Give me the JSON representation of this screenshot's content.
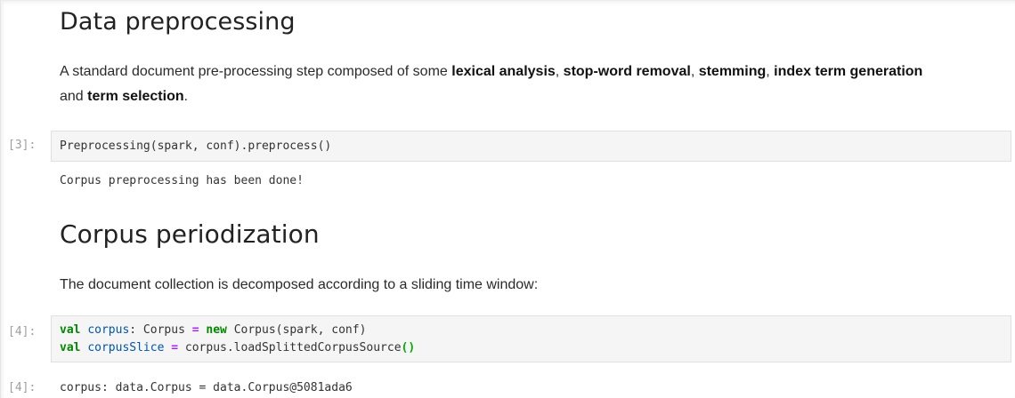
{
  "sections": [
    {
      "heading": "Data preprocessing",
      "paragraph": {
        "t1": "A standard document pre-processing step composed of some ",
        "b1": "lexical analysis",
        "t2": ", ",
        "b2": "stop-word removal",
        "t3": ", ",
        "b3": "stemming",
        "t4": ", ",
        "b4": "index term generation",
        "t5": " and ",
        "b5": "term selection",
        "t6": "."
      }
    },
    {
      "heading": "Corpus periodization",
      "paragraph": "The document collection is decomposed according to a sliding time window:"
    }
  ],
  "cells": [
    {
      "prompt": "[3]:",
      "code": "Preprocessing(spark, conf).preprocess()",
      "output": "Corpus preprocessing has been done!"
    },
    {
      "prompt": "[4]:",
      "code_lines": [
        {
          "kw": "val",
          "sp1": " ",
          "var": "corpus",
          "mid": ": Corpus ",
          "eq": "=",
          "sp2": " ",
          "new": "new",
          "rest": " Corpus(spark, conf)"
        },
        {
          "kw": "val",
          "sp1": " ",
          "var": "corpusSlice",
          "sp2": " ",
          "eq": "=",
          "rest": " corpus.loadSplittedCorpusSource",
          "parens": "()"
        }
      ],
      "output_prompt": "[4]:",
      "output": "corpus: data.Corpus = data.Corpus@5081ada6"
    }
  ]
}
